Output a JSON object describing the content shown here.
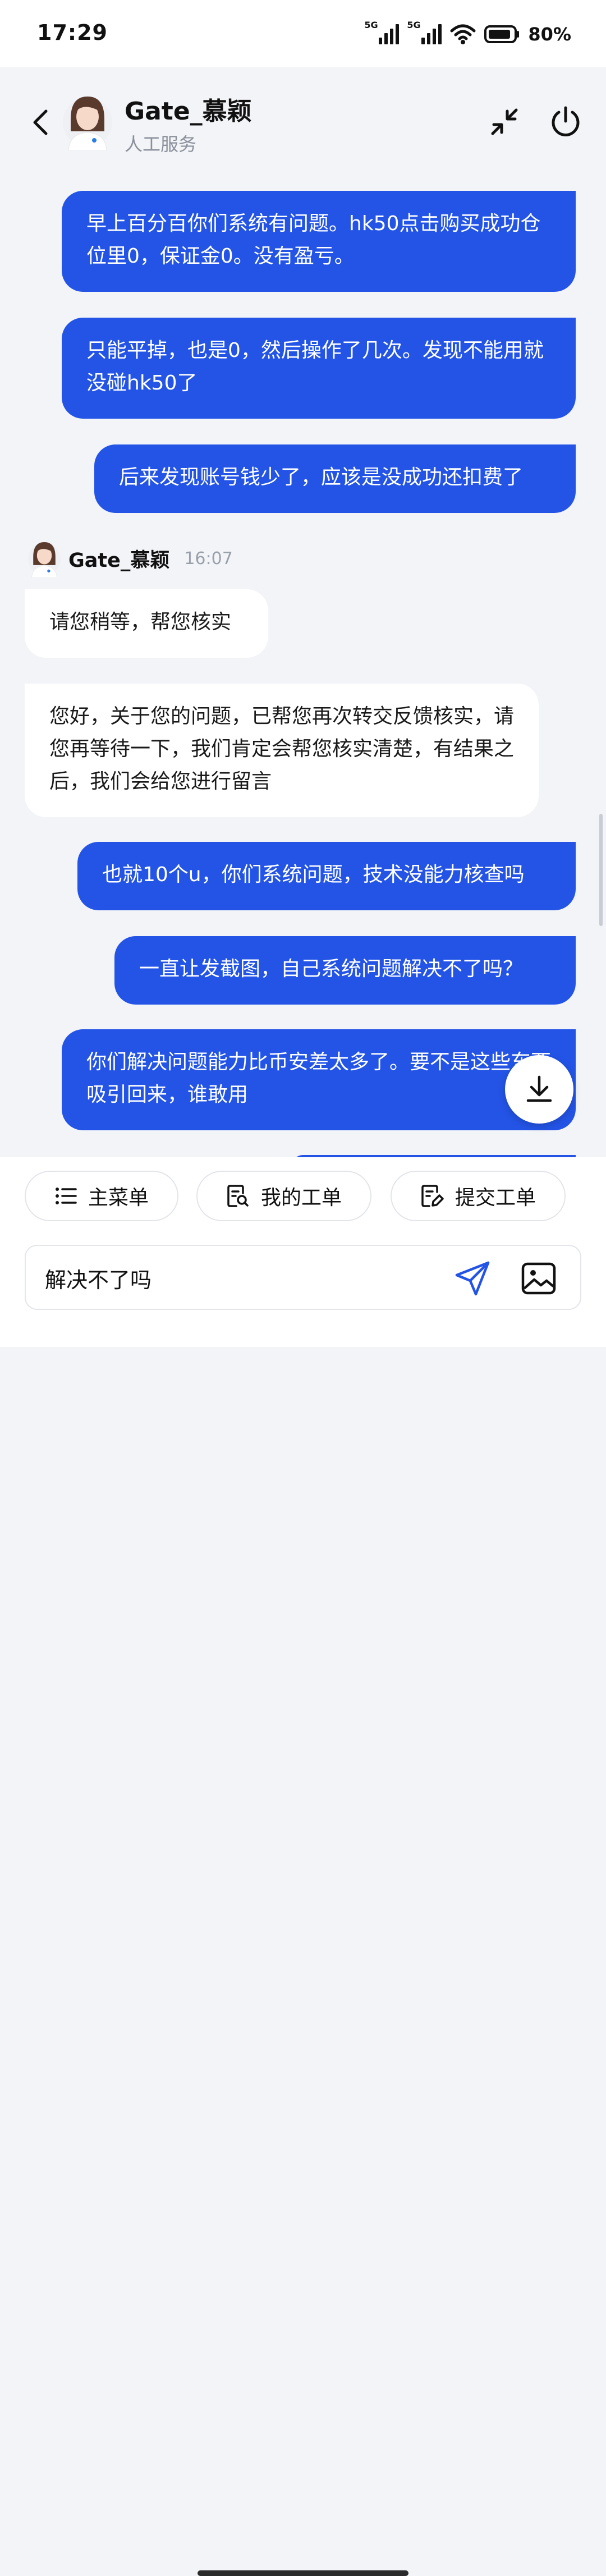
{
  "status_bar": {
    "time": "17:29",
    "signal_1": "5G",
    "signal_2": "5G",
    "battery": "80%",
    "icons": [
      "signal-icon",
      "signal-icon",
      "wifi-icon",
      "battery-icon"
    ]
  },
  "header": {
    "agent_name": "Gate_慕颖",
    "agent_status": "人工服务",
    "icons": [
      "back-arrow-icon",
      "minimize-icon",
      "power-icon"
    ]
  },
  "messages": [
    {
      "from": "user",
      "text": "早上百分百你们系统有问题。hk50点击购买成功仓位里0，保证金0。没有盈亏。"
    },
    {
      "from": "user",
      "text": "只能平掉，也是0，然后操作了几次。发现不能用就没碰hk50了"
    },
    {
      "from": "user",
      "text": "后来发现账号钱少了，应该是没成功还扣费了"
    },
    {
      "from": "agent",
      "text": "请您稍等，帮您核实"
    },
    {
      "from": "agent",
      "text": "您好，关于您的问题，已帮您再次转交反馈核实，请您再等待一下，我们肯定会帮您核实清楚，有结果之后，我们会给您进行留言"
    },
    {
      "from": "user",
      "text": "也就10个u，你们系统问题，技术没能力核查吗"
    },
    {
      "from": "user",
      "text": "一直让发截图，自己系统问题解决不了吗？"
    },
    {
      "from": "user",
      "text": "你们解决问题能力比币安差太多了。要不是这些东西吸引回来，谁敢用"
    }
  ],
  "agent_header": {
    "name": "Gate_慕颖",
    "time": "16:07"
  },
  "quick_actions": [
    "主菜单",
    "我的工单",
    "提交工单"
  ],
  "input": {
    "value": "解决不了吗"
  },
  "colors": {
    "user_bubble": "#2354e6",
    "agent_bubble": "#ffffff",
    "background": "#f2f4f8",
    "accent": "#2354e6"
  }
}
